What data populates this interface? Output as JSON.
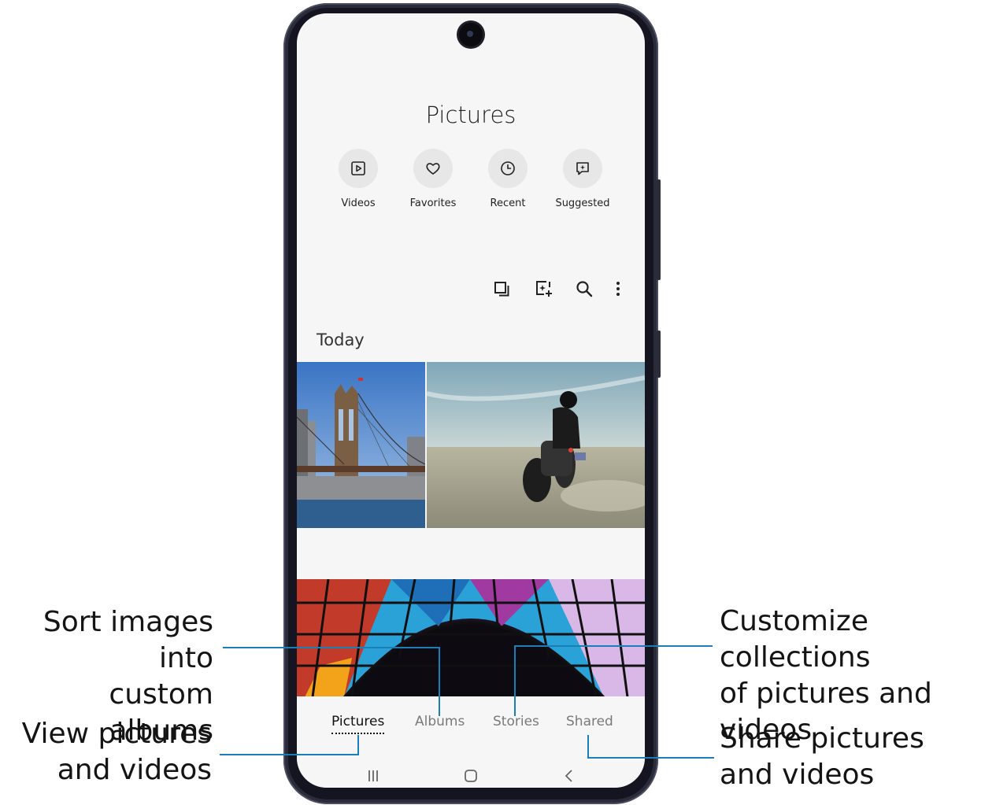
{
  "screen": {
    "title": "Pictures",
    "quick_actions": [
      {
        "label": "Videos",
        "icon": "play-square-icon"
      },
      {
        "label": "Favorites",
        "icon": "heart-icon"
      },
      {
        "label": "Recent",
        "icon": "clock-icon"
      },
      {
        "label": "Suggested",
        "icon": "sparkle-chat-icon"
      }
    ],
    "toolbar_icons": [
      "select-icon",
      "create-icon",
      "search-icon",
      "more-options-icon"
    ],
    "section_label": "Today",
    "photos": [
      "bridge-photo",
      "motorcycle-photo",
      "stained-glass-photo"
    ],
    "tabs": [
      {
        "label": "Pictures",
        "active": true
      },
      {
        "label": "Albums",
        "active": false
      },
      {
        "label": "Stories",
        "active": false
      },
      {
        "label": "Shared",
        "active": false
      }
    ],
    "system_nav": [
      "recent-apps-icon",
      "home-icon",
      "back-icon"
    ]
  },
  "callouts": {
    "albums": {
      "line1": "Sort images into",
      "line2": "custom albums"
    },
    "pictures": {
      "line1": "View pictures",
      "line2": "and videos"
    },
    "stories": {
      "line1": "Customize collections",
      "line2": "of pictures and videos"
    },
    "shared": {
      "line1": "Share pictures",
      "line2": "and videos"
    }
  },
  "colors": {
    "callout_line": "#1a7fb8",
    "screen_bg": "#f6f6f6",
    "phone_frame": "#2a2c3a"
  }
}
